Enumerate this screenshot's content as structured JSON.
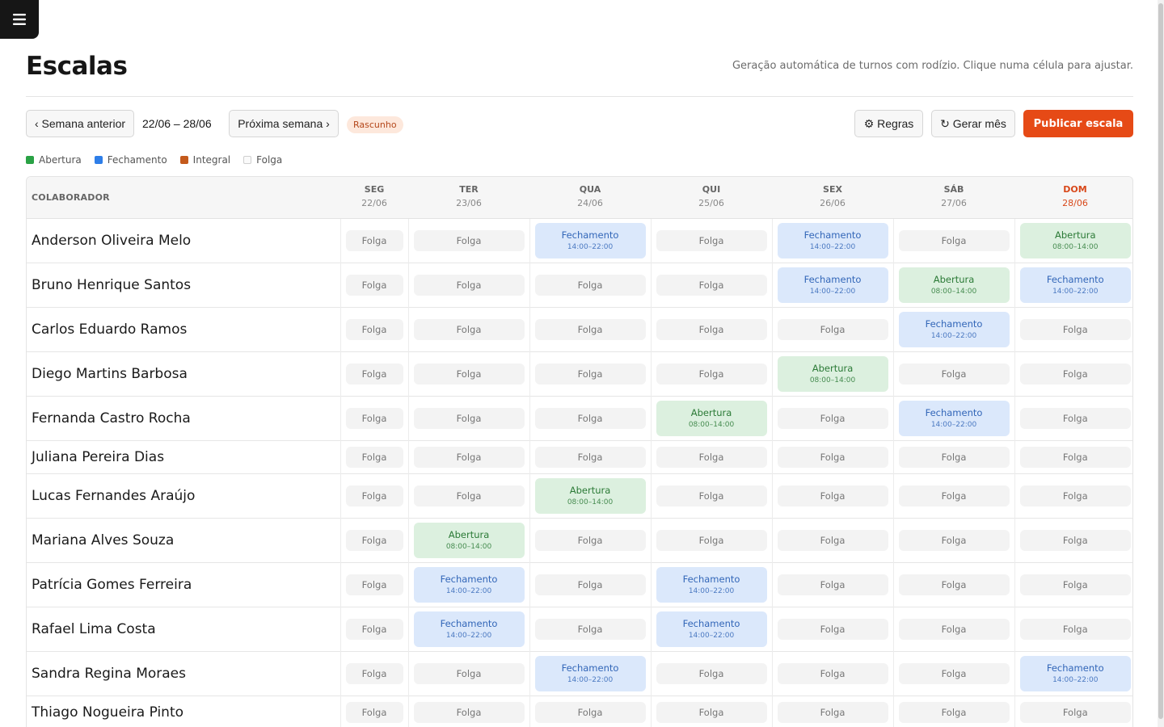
{
  "app": {
    "title": "Escalas",
    "subtitle": "Geração automática de turnos com rodízio. Clique numa célula para ajustar."
  },
  "toolbar": {
    "prev_label": "‹ Semana anterior",
    "week_range": "22/06 – 28/06",
    "next_label": "Próxima semana ›",
    "status_badge": "Rascunho",
    "rules_label": "⚙ Regras",
    "generate_label": "↻ Gerar mês",
    "publish_label": "Publicar escala"
  },
  "legend": [
    {
      "label": "Abertura",
      "color": "#2aa245"
    },
    {
      "label": "Fechamento",
      "color": "#2e7ee8"
    },
    {
      "label": "Integral",
      "color": "#c45a1c"
    },
    {
      "label": "Folga",
      "color": "#fafafa"
    }
  ],
  "colors": {
    "accent": "#e64a16",
    "abertura_bg": "#dcf0df",
    "fechamento_bg": "#dbe8fb",
    "folga_bg": "#f3f3f3"
  },
  "table": {
    "name_header": "COLABORADOR",
    "days": [
      {
        "abbr": "SEG",
        "date": "22/06"
      },
      {
        "abbr": "TER",
        "date": "23/06"
      },
      {
        "abbr": "QUA",
        "date": "24/06"
      },
      {
        "abbr": "QUI",
        "date": "25/06"
      },
      {
        "abbr": "SEX",
        "date": "26/06"
      },
      {
        "abbr": "SÁB",
        "date": "27/06"
      },
      {
        "abbr": "DOM",
        "date": "28/06"
      }
    ],
    "rows": [
      {
        "name": "Anderson Oliveira Melo",
        "shifts": [
          {
            "type": "folga",
            "label": "Folga",
            "time": ""
          },
          {
            "type": "folga",
            "label": "Folga",
            "time": ""
          },
          {
            "type": "fechamento",
            "label": "Fechamento",
            "time": "14:00–22:00"
          },
          {
            "type": "folga",
            "label": "Folga",
            "time": ""
          },
          {
            "type": "fechamento",
            "label": "Fechamento",
            "time": "14:00–22:00"
          },
          {
            "type": "folga",
            "label": "Folga",
            "time": ""
          },
          {
            "type": "abertura",
            "label": "Abertura",
            "time": "08:00–14:00"
          }
        ]
      },
      {
        "name": "Bruno Henrique Santos",
        "shifts": [
          {
            "type": "folga",
            "label": "Folga",
            "time": ""
          },
          {
            "type": "folga",
            "label": "Folga",
            "time": ""
          },
          {
            "type": "folga",
            "label": "Folga",
            "time": ""
          },
          {
            "type": "folga",
            "label": "Folga",
            "time": ""
          },
          {
            "type": "fechamento",
            "label": "Fechamento",
            "time": "14:00–22:00"
          },
          {
            "type": "abertura",
            "label": "Abertura",
            "time": "08:00–14:00"
          },
          {
            "type": "fechamento",
            "label": "Fechamento",
            "time": "14:00–22:00"
          }
        ]
      },
      {
        "name": "Carlos Eduardo Ramos",
        "shifts": [
          {
            "type": "folga",
            "label": "Folga",
            "time": ""
          },
          {
            "type": "folga",
            "label": "Folga",
            "time": ""
          },
          {
            "type": "folga",
            "label": "Folga",
            "time": ""
          },
          {
            "type": "folga",
            "label": "Folga",
            "time": ""
          },
          {
            "type": "folga",
            "label": "Folga",
            "time": ""
          },
          {
            "type": "fechamento",
            "label": "Fechamento",
            "time": "14:00–22:00"
          },
          {
            "type": "folga",
            "label": "Folga",
            "time": ""
          }
        ]
      },
      {
        "name": "Diego Martins Barbosa",
        "shifts": [
          {
            "type": "folga",
            "label": "Folga",
            "time": ""
          },
          {
            "type": "folga",
            "label": "Folga",
            "time": ""
          },
          {
            "type": "folga",
            "label": "Folga",
            "time": ""
          },
          {
            "type": "folga",
            "label": "Folga",
            "time": ""
          },
          {
            "type": "abertura",
            "label": "Abertura",
            "time": "08:00–14:00"
          },
          {
            "type": "folga",
            "label": "Folga",
            "time": ""
          },
          {
            "type": "folga",
            "label": "Folga",
            "time": ""
          }
        ]
      },
      {
        "name": "Fernanda Castro Rocha",
        "shifts": [
          {
            "type": "folga",
            "label": "Folga",
            "time": ""
          },
          {
            "type": "folga",
            "label": "Folga",
            "time": ""
          },
          {
            "type": "folga",
            "label": "Folga",
            "time": ""
          },
          {
            "type": "abertura",
            "label": "Abertura",
            "time": "08:00–14:00"
          },
          {
            "type": "folga",
            "label": "Folga",
            "time": ""
          },
          {
            "type": "fechamento",
            "label": "Fechamento",
            "time": "14:00–22:00"
          },
          {
            "type": "folga",
            "label": "Folga",
            "time": ""
          }
        ]
      },
      {
        "name": "Juliana Pereira Dias",
        "shifts": [
          {
            "type": "folga",
            "label": "Folga",
            "time": ""
          },
          {
            "type": "folga",
            "label": "Folga",
            "time": ""
          },
          {
            "type": "folga",
            "label": "Folga",
            "time": ""
          },
          {
            "type": "folga",
            "label": "Folga",
            "time": ""
          },
          {
            "type": "folga",
            "label": "Folga",
            "time": ""
          },
          {
            "type": "folga",
            "label": "Folga",
            "time": ""
          },
          {
            "type": "folga",
            "label": "Folga",
            "time": ""
          }
        ]
      },
      {
        "name": "Lucas Fernandes Araújo",
        "shifts": [
          {
            "type": "folga",
            "label": "Folga",
            "time": ""
          },
          {
            "type": "folga",
            "label": "Folga",
            "time": ""
          },
          {
            "type": "abertura",
            "label": "Abertura",
            "time": "08:00–14:00"
          },
          {
            "type": "folga",
            "label": "Folga",
            "time": ""
          },
          {
            "type": "folga",
            "label": "Folga",
            "time": ""
          },
          {
            "type": "folga",
            "label": "Folga",
            "time": ""
          },
          {
            "type": "folga",
            "label": "Folga",
            "time": ""
          }
        ]
      },
      {
        "name": "Mariana Alves Souza",
        "shifts": [
          {
            "type": "folga",
            "label": "Folga",
            "time": ""
          },
          {
            "type": "abertura",
            "label": "Abertura",
            "time": "08:00–14:00"
          },
          {
            "type": "folga",
            "label": "Folga",
            "time": ""
          },
          {
            "type": "folga",
            "label": "Folga",
            "time": ""
          },
          {
            "type": "folga",
            "label": "Folga",
            "time": ""
          },
          {
            "type": "folga",
            "label": "Folga",
            "time": ""
          },
          {
            "type": "folga",
            "label": "Folga",
            "time": ""
          }
        ]
      },
      {
        "name": "Patrícia Gomes Ferreira",
        "shifts": [
          {
            "type": "folga",
            "label": "Folga",
            "time": ""
          },
          {
            "type": "fechamento",
            "label": "Fechamento",
            "time": "14:00–22:00"
          },
          {
            "type": "folga",
            "label": "Folga",
            "time": ""
          },
          {
            "type": "fechamento",
            "label": "Fechamento",
            "time": "14:00–22:00"
          },
          {
            "type": "folga",
            "label": "Folga",
            "time": ""
          },
          {
            "type": "folga",
            "label": "Folga",
            "time": ""
          },
          {
            "type": "folga",
            "label": "Folga",
            "time": ""
          }
        ]
      },
      {
        "name": "Rafael Lima Costa",
        "shifts": [
          {
            "type": "folga",
            "label": "Folga",
            "time": ""
          },
          {
            "type": "fechamento",
            "label": "Fechamento",
            "time": "14:00–22:00"
          },
          {
            "type": "folga",
            "label": "Folga",
            "time": ""
          },
          {
            "type": "fechamento",
            "label": "Fechamento",
            "time": "14:00–22:00"
          },
          {
            "type": "folga",
            "label": "Folga",
            "time": ""
          },
          {
            "type": "folga",
            "label": "Folga",
            "time": ""
          },
          {
            "type": "folga",
            "label": "Folga",
            "time": ""
          }
        ]
      },
      {
        "name": "Sandra Regina Moraes",
        "shifts": [
          {
            "type": "folga",
            "label": "Folga",
            "time": ""
          },
          {
            "type": "folga",
            "label": "Folga",
            "time": ""
          },
          {
            "type": "fechamento",
            "label": "Fechamento",
            "time": "14:00–22:00"
          },
          {
            "type": "folga",
            "label": "Folga",
            "time": ""
          },
          {
            "type": "folga",
            "label": "Folga",
            "time": ""
          },
          {
            "type": "folga",
            "label": "Folga",
            "time": ""
          },
          {
            "type": "fechamento",
            "label": "Fechamento",
            "time": "14:00–22:00"
          }
        ]
      },
      {
        "name": "Thiago Nogueira Pinto",
        "shifts": [
          {
            "type": "folga",
            "label": "Folga",
            "time": ""
          },
          {
            "type": "folga",
            "label": "Folga",
            "time": ""
          },
          {
            "type": "folga",
            "label": "Folga",
            "time": ""
          },
          {
            "type": "folga",
            "label": "Folga",
            "time": ""
          },
          {
            "type": "folga",
            "label": "Folga",
            "time": ""
          },
          {
            "type": "folga",
            "label": "Folga",
            "time": ""
          },
          {
            "type": "folga",
            "label": "Folga",
            "time": ""
          }
        ]
      }
    ]
  }
}
